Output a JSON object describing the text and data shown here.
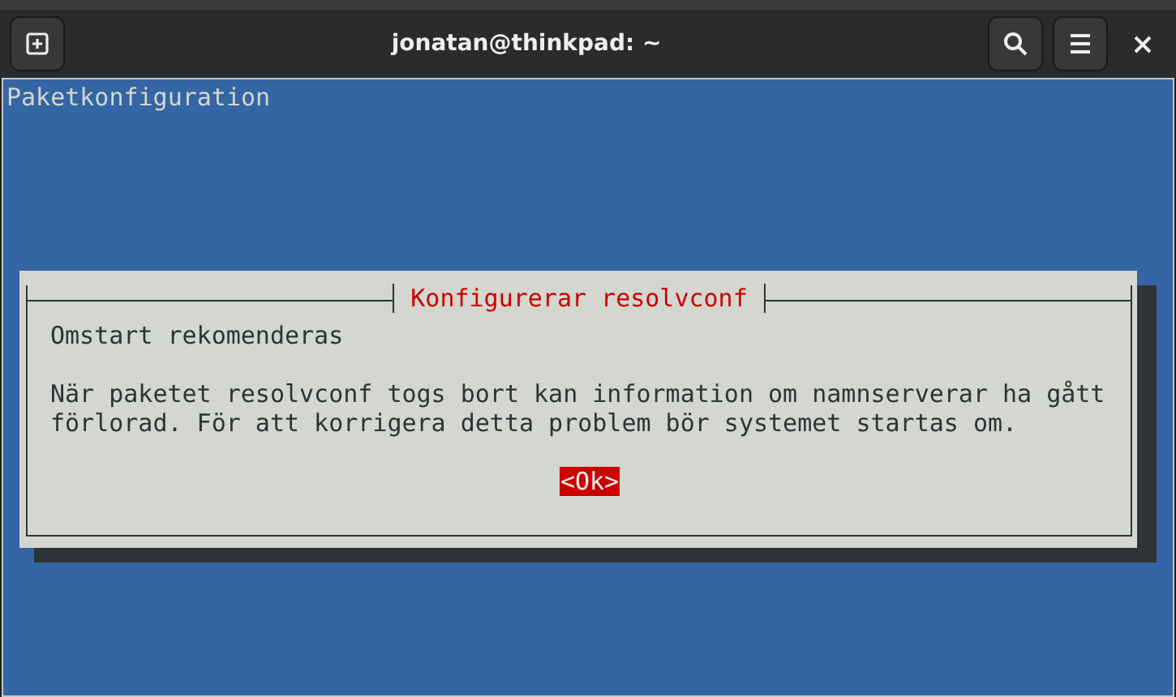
{
  "window": {
    "title": "jonatan@thinkpad: ~"
  },
  "terminal": {
    "backtitle": "Paketkonfiguration",
    "dialog": {
      "title": "Konfigurerar resolvconf",
      "heading": "Omstart rekomenderas",
      "message_lines": [
        "När paketet resolvconf togs bort kan information om namnserverar ha gått",
        "förlorad. För att korrigera detta problem bör systemet startas om."
      ],
      "buttons": [
        {
          "label": "<Ok>",
          "selected": true
        }
      ]
    }
  }
}
